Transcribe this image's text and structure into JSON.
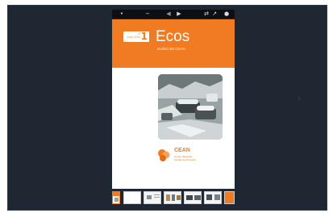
{
  "toolbar": {
    "buttons": [
      {
        "name": "zoom-out-icon",
        "glyph": "−"
      },
      {
        "name": "zoom-in-icon",
        "glyph": "+"
      },
      {
        "name": "previous-page-icon",
        "glyph": "◀"
      },
      {
        "name": "play-icon",
        "glyph": "▶"
      },
      {
        "name": "share-icon",
        "glyph": "⇄"
      },
      {
        "name": "settings-icon",
        "glyph": "●"
      }
    ]
  },
  "cover": {
    "issue_label": "nº\nJuny 2011",
    "issue_number": "1",
    "title": "Ecos",
    "subtitle": "Butlletí del CEAN"
  },
  "logo": {
    "name": "CEAN",
    "tagline_line1": "Centre d'Estudis",
    "tagline_line2": "Socials del Penedès"
  },
  "navigation": {
    "next_glyph": "›",
    "prev_glyph": "‹"
  },
  "colors": {
    "accent": "#f07b22",
    "frame": "#1e2732",
    "toolbar": "#0d0f12"
  }
}
